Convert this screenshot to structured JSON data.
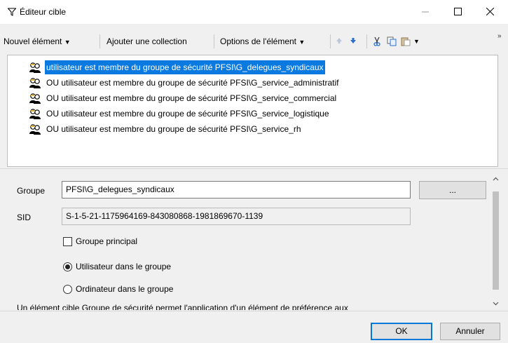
{
  "window": {
    "title": "Éditeur cible",
    "title_icon": "filter-icon",
    "controls": [
      "minimize",
      "maximize",
      "close"
    ]
  },
  "toolbar": {
    "new_item": "Nouvel élément",
    "add_collection": "Ajouter une collection",
    "item_options": "Options de l'élément",
    "icons": [
      "move-up-icon",
      "move-down-icon",
      "cut-icon",
      "copy-icon",
      "paste-icon"
    ]
  },
  "list": {
    "items": [
      {
        "label": "utilisateur est membre du groupe de sécurité PFSI\\G_delegues_syndicaux",
        "selected": true,
        "icon": "security-group-icon"
      },
      {
        "label": "OU utilisateur est membre du groupe de sécurité PFSI\\G_service_administratif",
        "selected": false,
        "icon": "security-group-icon"
      },
      {
        "label": "OU utilisateur est membre du groupe de sécurité PFSI\\G_service_commercial",
        "selected": false,
        "icon": "security-group-icon"
      },
      {
        "label": "OU utilisateur est membre du groupe de sécurité PFSI\\G_service_logistique",
        "selected": false,
        "icon": "security-group-icon"
      },
      {
        "label": "OU utilisateur est membre du groupe de sécurité PFSI\\G_service_rh",
        "selected": false,
        "icon": "security-group-icon"
      }
    ]
  },
  "props": {
    "group_label": "Groupe",
    "group_value": "PFSI\\G_delegues_syndicaux",
    "browse_label": "...",
    "sid_label": "SID",
    "sid_value": "S-1-5-21-1175964169-843080868-1981869670-1139",
    "primary_group_label": "Groupe principal",
    "primary_group_checked": false,
    "user_in_group_label": "Utilisateur dans le groupe",
    "computer_in_group_label": "Ordinateur dans le groupe",
    "selected_option": "user",
    "description": "Un élément cible Groupe de sécurité permet l'application d'un élément de préférence aux"
  },
  "buttons": {
    "ok": "OK",
    "cancel": "Annuler"
  },
  "colors": {
    "selection": "#0a7ae0",
    "accent": "#0078d7"
  }
}
